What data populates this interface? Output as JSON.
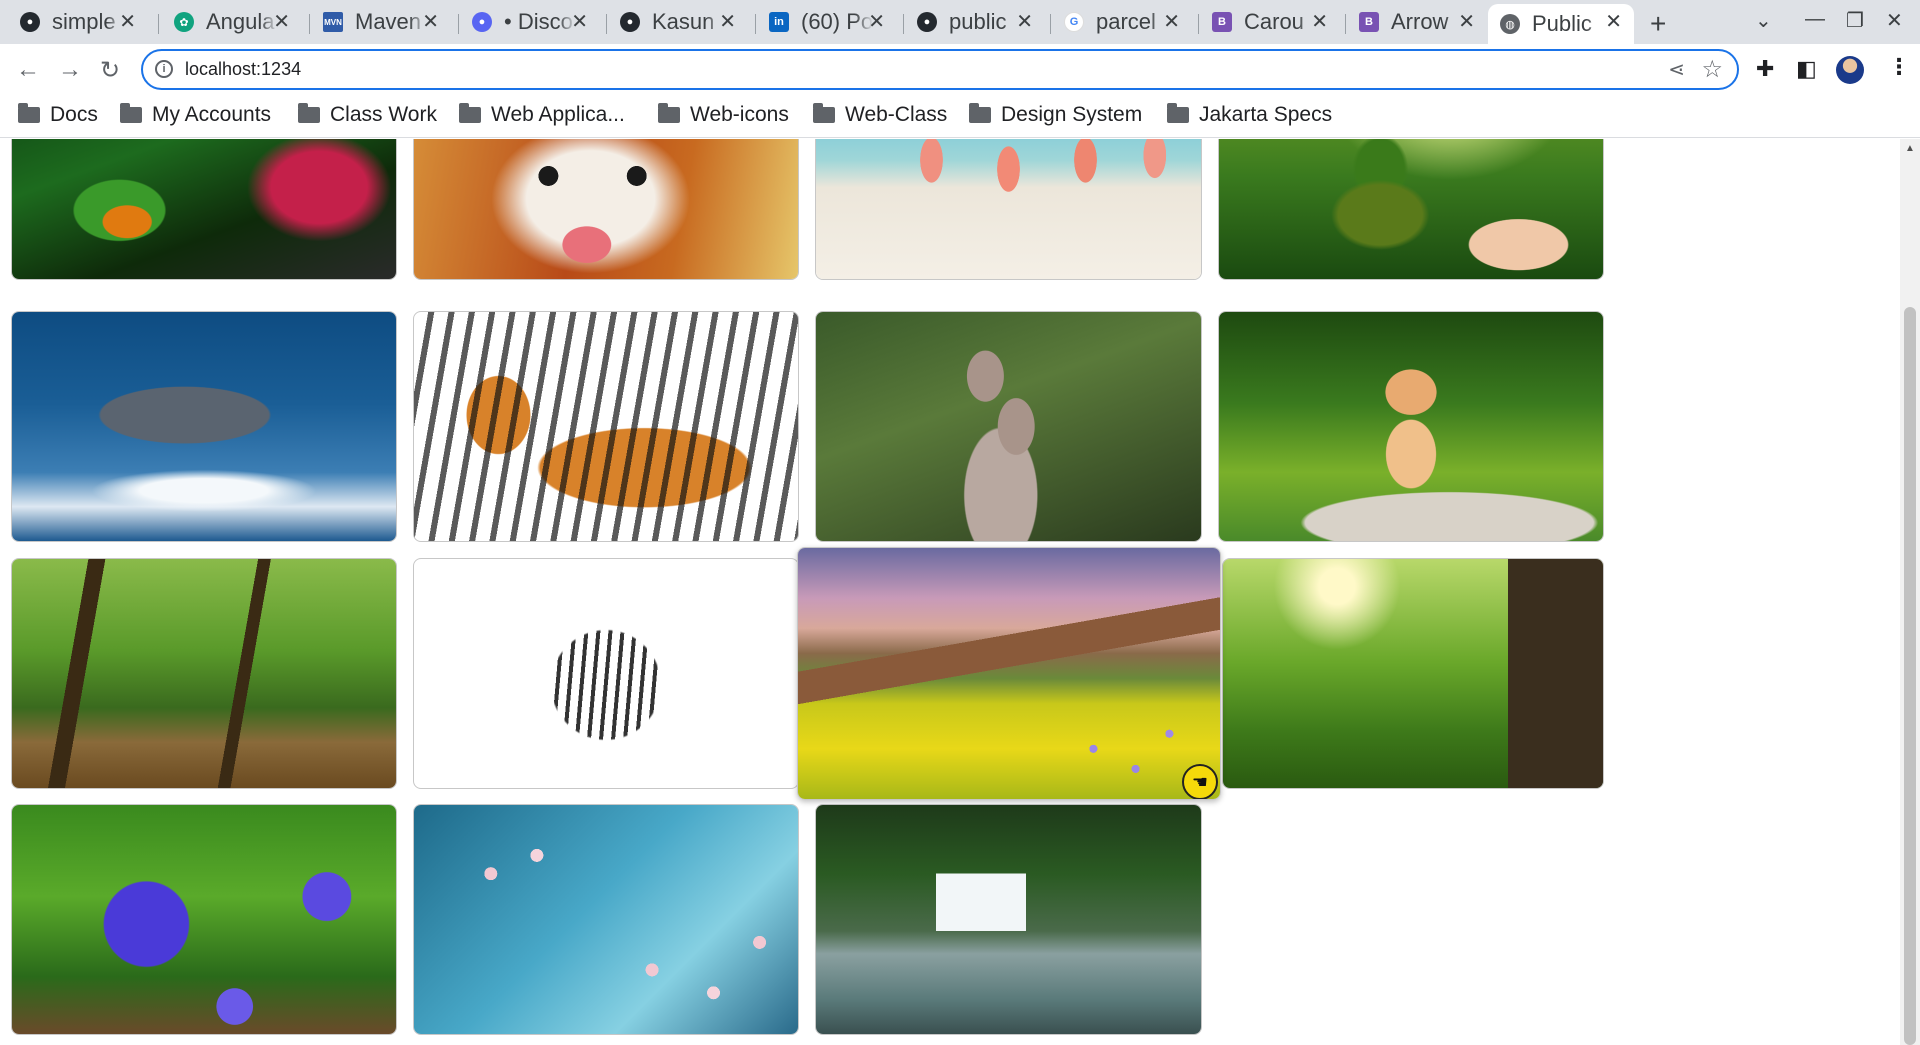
{
  "tabs": [
    {
      "title": "simple",
      "icon": "github-icon"
    },
    {
      "title": "Angula",
      "icon": "chatgpt-icon"
    },
    {
      "title": "Maven",
      "icon": "maven-icon"
    },
    {
      "title": "• Disco",
      "icon": "discord-icon"
    },
    {
      "title": "Kasun",
      "icon": "github-icon"
    },
    {
      "title": "(60) Po",
      "icon": "linkedin-icon"
    },
    {
      "title": "public",
      "icon": "github-icon"
    },
    {
      "title": "parcel",
      "icon": "google-icon"
    },
    {
      "title": "Carou",
      "icon": "bootstrap-icon"
    },
    {
      "title": "Arrow",
      "icon": "bootstrap-icon"
    },
    {
      "title": "Public",
      "icon": "globe-icon",
      "active": true
    }
  ],
  "toolbar": {
    "url": "localhost:1234"
  },
  "bookmarks": [
    "Docs",
    "My Accounts",
    "Class Work",
    "Web Applica...",
    "Web-icons",
    "Web-Class",
    "Design System",
    "Jakarta Specs"
  ],
  "gallery": {
    "photos": [
      {
        "subject": "red-eyed tree frog"
      },
      {
        "subject": "red panda"
      },
      {
        "subject": "flamingos on beach"
      },
      {
        "subject": "hand holding tree"
      },
      {
        "subject": "dolphin"
      },
      {
        "subject": "tiger"
      },
      {
        "subject": "meerkats"
      },
      {
        "subject": "kitten"
      },
      {
        "subject": "forest trees"
      },
      {
        "subject": "zebra"
      },
      {
        "subject": "mountain flower meadow",
        "hovered": true
      },
      {
        "subject": "sunlit meadow"
      },
      {
        "subject": "purple balloon flower"
      },
      {
        "subject": "cherry blossom"
      },
      {
        "subject": "waterfall"
      }
    ]
  },
  "colors": {
    "tab_strip": "#dee1e6",
    "omnibox_border": "#1a73e8",
    "cursor_highlight": "#f5d90a"
  }
}
